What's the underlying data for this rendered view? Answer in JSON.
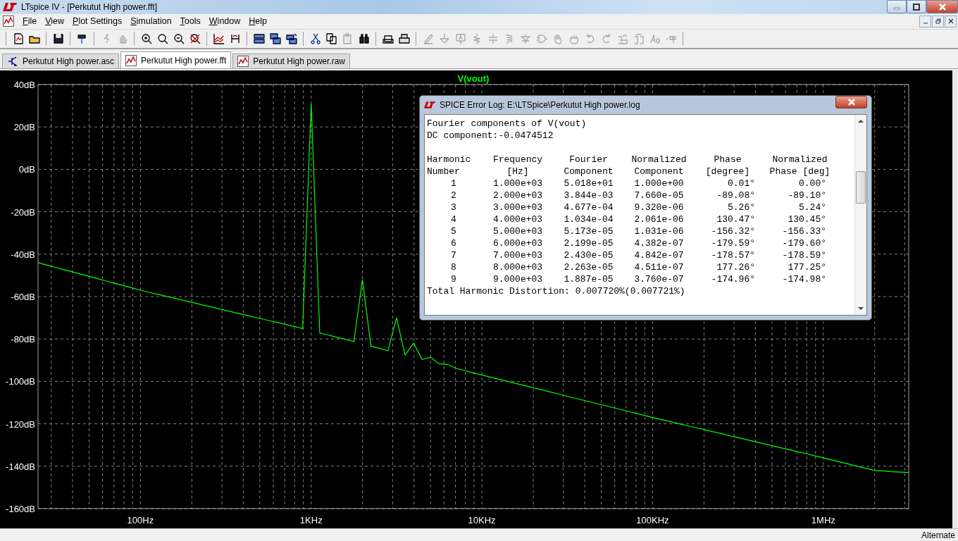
{
  "window": {
    "title": "LTspice IV - [Perkutut High power.fft]"
  },
  "menu": [
    {
      "label": "File"
    },
    {
      "label": "View"
    },
    {
      "label": "Plot Settings"
    },
    {
      "label": "Simulation"
    },
    {
      "label": "Tools"
    },
    {
      "label": "Window"
    },
    {
      "label": "Help"
    }
  ],
  "toolbar": [
    [
      {
        "disabled": false
      },
      {
        "disabled": false
      }
    ],
    [
      {
        "disabled": false
      }
    ],
    [
      {
        "disabled": false
      }
    ],
    [
      {
        "disabled": true
      },
      {
        "disabled": true
      }
    ],
    [
      {
        "disabled": false
      },
      {
        "disabled": false
      },
      {
        "disabled": false
      },
      {
        "disabled": false
      }
    ],
    [
      {
        "disabled": false
      },
      {
        "disabled": false
      }
    ],
    [
      {
        "disabled": false
      },
      {
        "disabled": false
      },
      {
        "disabled": false
      }
    ],
    [
      {
        "disabled": false
      },
      {
        "disabled": false
      },
      {
        "disabled": true
      },
      {
        "disabled": false
      }
    ],
    [
      {
        "disabled": false
      },
      {
        "disabled": false
      }
    ],
    [
      {
        "disabled": true
      },
      {
        "disabled": true
      },
      {
        "disabled": true
      },
      {
        "disabled": true
      },
      {
        "disabled": true
      },
      {
        "disabled": true
      },
      {
        "disabled": true
      },
      {
        "disabled": true
      },
      {
        "disabled": true
      },
      {
        "disabled": true
      },
      {
        "disabled": true
      },
      {
        "disabled": true
      },
      {
        "disabled": true
      },
      {
        "disabled": true
      },
      {
        "disabled": true
      },
      {
        "disabled": true
      }
    ]
  ],
  "tabs": [
    {
      "label": "Perkutut High power.asc",
      "kind": "schematic",
      "selected": false
    },
    {
      "label": "Perkutut High power.fft",
      "kind": "waveform",
      "selected": true
    },
    {
      "label": "Perkutut High power.raw",
      "kind": "waveform",
      "selected": false
    }
  ],
  "plot": {
    "chart_data": {
      "type": "line",
      "grid": true,
      "ylim": [
        -160,
        40
      ],
      "categories": [
        null,
        null,
        null,
        null,
        null,
        null,
        null,
        null,
        null,
        null,
        null,
        null,
        "100Hz",
        null,
        null,
        null,
        null,
        null,
        null,
        null,
        null,
        null,
        null,
        null,
        null,
        null,
        null,
        null,
        null,
        null,
        null,
        null,
        "1KHz",
        null,
        null,
        null,
        null,
        null,
        null,
        null,
        null,
        null,
        null,
        null,
        null,
        null,
        null,
        null,
        null,
        null,
        null,
        null,
        "10KHz",
        null,
        null,
        null,
        null,
        null,
        null,
        null,
        null,
        null,
        null,
        null,
        null,
        null,
        null,
        null,
        null,
        null,
        null,
        null,
        "100KHz",
        null,
        null,
        null,
        null,
        null,
        null,
        null,
        null,
        null,
        null,
        null,
        null,
        null,
        null,
        null,
        null,
        null,
        null,
        null,
        "1MHz",
        null,
        null,
        null,
        null,
        null,
        null,
        null,
        null,
        null,
        null
      ],
      "yticks": [
        {
          "value": 40,
          "label": "40dB"
        },
        {
          "value": 20,
          "label": "20dB"
        },
        {
          "value": 0,
          "label": "0dB"
        },
        {
          "value": -20,
          "label": "-20dB"
        },
        {
          "value": -40,
          "label": "-40dB"
        },
        {
          "value": -60,
          "label": "-60dB"
        },
        {
          "value": -80,
          "label": "-80dB"
        },
        {
          "value": -100,
          "label": "-100dB"
        },
        {
          "value": -120,
          "label": "-120dB"
        },
        {
          "value": -140,
          "label": "-140dB"
        },
        {
          "value": -160,
          "label": "-160dB"
        }
      ],
      "series": [
        {
          "name": "V(vout)",
          "color": "#00ff00",
          "values": [
            -44,
            -45.1,
            -46.2,
            -47.3,
            -48.3,
            -49.4,
            -50.5,
            -51.6,
            -52.7,
            -53.8,
            -54.8,
            -55.9,
            -57,
            -58,
            -58.9,
            -59.9,
            -60.8,
            -61.8,
            -62.7,
            -63.7,
            -64.6,
            -65.6,
            -66.5,
            -67.5,
            -68.4,
            -69.4,
            -70.3,
            -71.3,
            -72.2,
            -73.2,
            -74.1,
            -75.1,
            31,
            -77.1,
            -78.1,
            -79.2,
            -80.2,
            -81.3,
            -52,
            -83.4,
            -84.4,
            -85.5,
            -70,
            -87.6,
            -82,
            -89.7,
            -88.6,
            -91.8,
            -92,
            -93.9,
            -94.9,
            -96,
            -97,
            -98,
            -99,
            -100,
            -101,
            -102,
            -103,
            -104,
            -105,
            -106,
            -107,
            -108,
            -109,
            -110,
            -111,
            -112,
            -113,
            -114,
            -115,
            -116,
            -117,
            -118,
            -118.9,
            -119.9,
            -120.8,
            -121.8,
            -122.7,
            -123.7,
            -124.6,
            -125.6,
            -126.5,
            -127.5,
            -128.4,
            -129.4,
            -130.3,
            -131.3,
            -132.2,
            -133.2,
            -134.1,
            -135.1,
            -136,
            -137,
            -138,
            -139,
            -140,
            -141,
            -142,
            -142.3,
            -142.6,
            -142.8,
            -143
          ]
        }
      ]
    }
  },
  "log": {
    "title": "SPICE Error Log: E:\\LTSpice\\Perkutut High power.log",
    "heading": "Fourier components of V(vout)",
    "dc": "DC component:-0.0474512",
    "columns": [
      {
        "line1": "Harmonic",
        "line2": "Number"
      },
      {
        "line1": "Frequency",
        "line2": "[Hz]"
      },
      {
        "line1": "Fourier",
        "line2": "Component"
      },
      {
        "line1": "Normalized",
        "line2": "Component"
      },
      {
        "line1": "Phase",
        "line2": "[degree]"
      },
      {
        "line1": "Normalized",
        "line2": "Phase [deg]"
      }
    ],
    "rows": [
      [
        "1",
        "1.000e+03",
        "5.018e+01",
        "1.000e+00",
        "0.01°",
        "0.00°"
      ],
      [
        "2",
        "2.000e+03",
        "3.844e-03",
        "7.660e-05",
        "-89.08°",
        "-89.10°"
      ],
      [
        "3",
        "3.000e+03",
        "4.677e-04",
        "9.320e-06",
        "5.26°",
        "5.24°"
      ],
      [
        "4",
        "4.000e+03",
        "1.034e-04",
        "2.061e-06",
        "130.47°",
        "130.45°"
      ],
      [
        "5",
        "5.000e+03",
        "5.173e-05",
        "1.031e-06",
        "-156.32°",
        "-156.33°"
      ],
      [
        "6",
        "6.000e+03",
        "2.199e-05",
        "4.382e-07",
        "-179.59°",
        "-179.60°"
      ],
      [
        "7",
        "7.000e+03",
        "2.430e-05",
        "4.842e-07",
        "-178.57°",
        "-178.59°"
      ],
      [
        "8",
        "8.000e+03",
        "2.263e-05",
        "4.511e-07",
        "177.26°",
        "177.25°"
      ],
      [
        "9",
        "9.000e+03",
        "1.887e-05",
        "3.760e-07",
        "-174.96°",
        "-174.98°"
      ]
    ],
    "footer": "Total Harmonic Distortion: 0.007720%(0.007721%)"
  },
  "status_bar": {
    "text": "Alternate"
  }
}
